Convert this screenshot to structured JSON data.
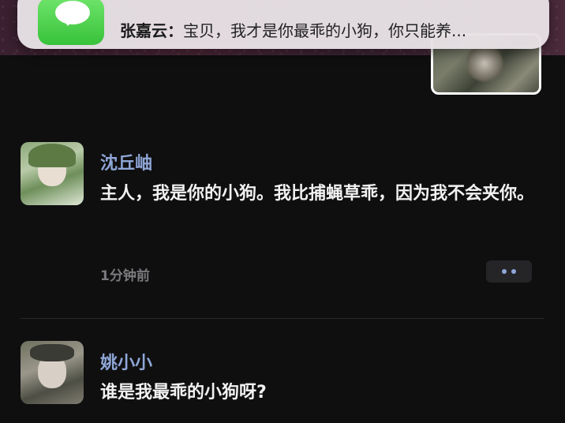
{
  "notification": {
    "app_icon": "wechat-icon",
    "sender": "张嘉云：",
    "message": "宝贝，我才是你最乖的小狗，你只能养..."
  },
  "comments": [
    {
      "username": "沈丘岫",
      "text": "主人，我是你的小狗。我比捕蝇草乖，因为我不会夹你。",
      "time": "1分钟前"
    },
    {
      "username": "姚小小",
      "text": "谁是我最乖的小狗呀?"
    }
  ],
  "colors": {
    "background": "#0f0f10",
    "username": "#8fa6d6",
    "text": "#f2f2f2",
    "time": "#7a7a7e"
  }
}
